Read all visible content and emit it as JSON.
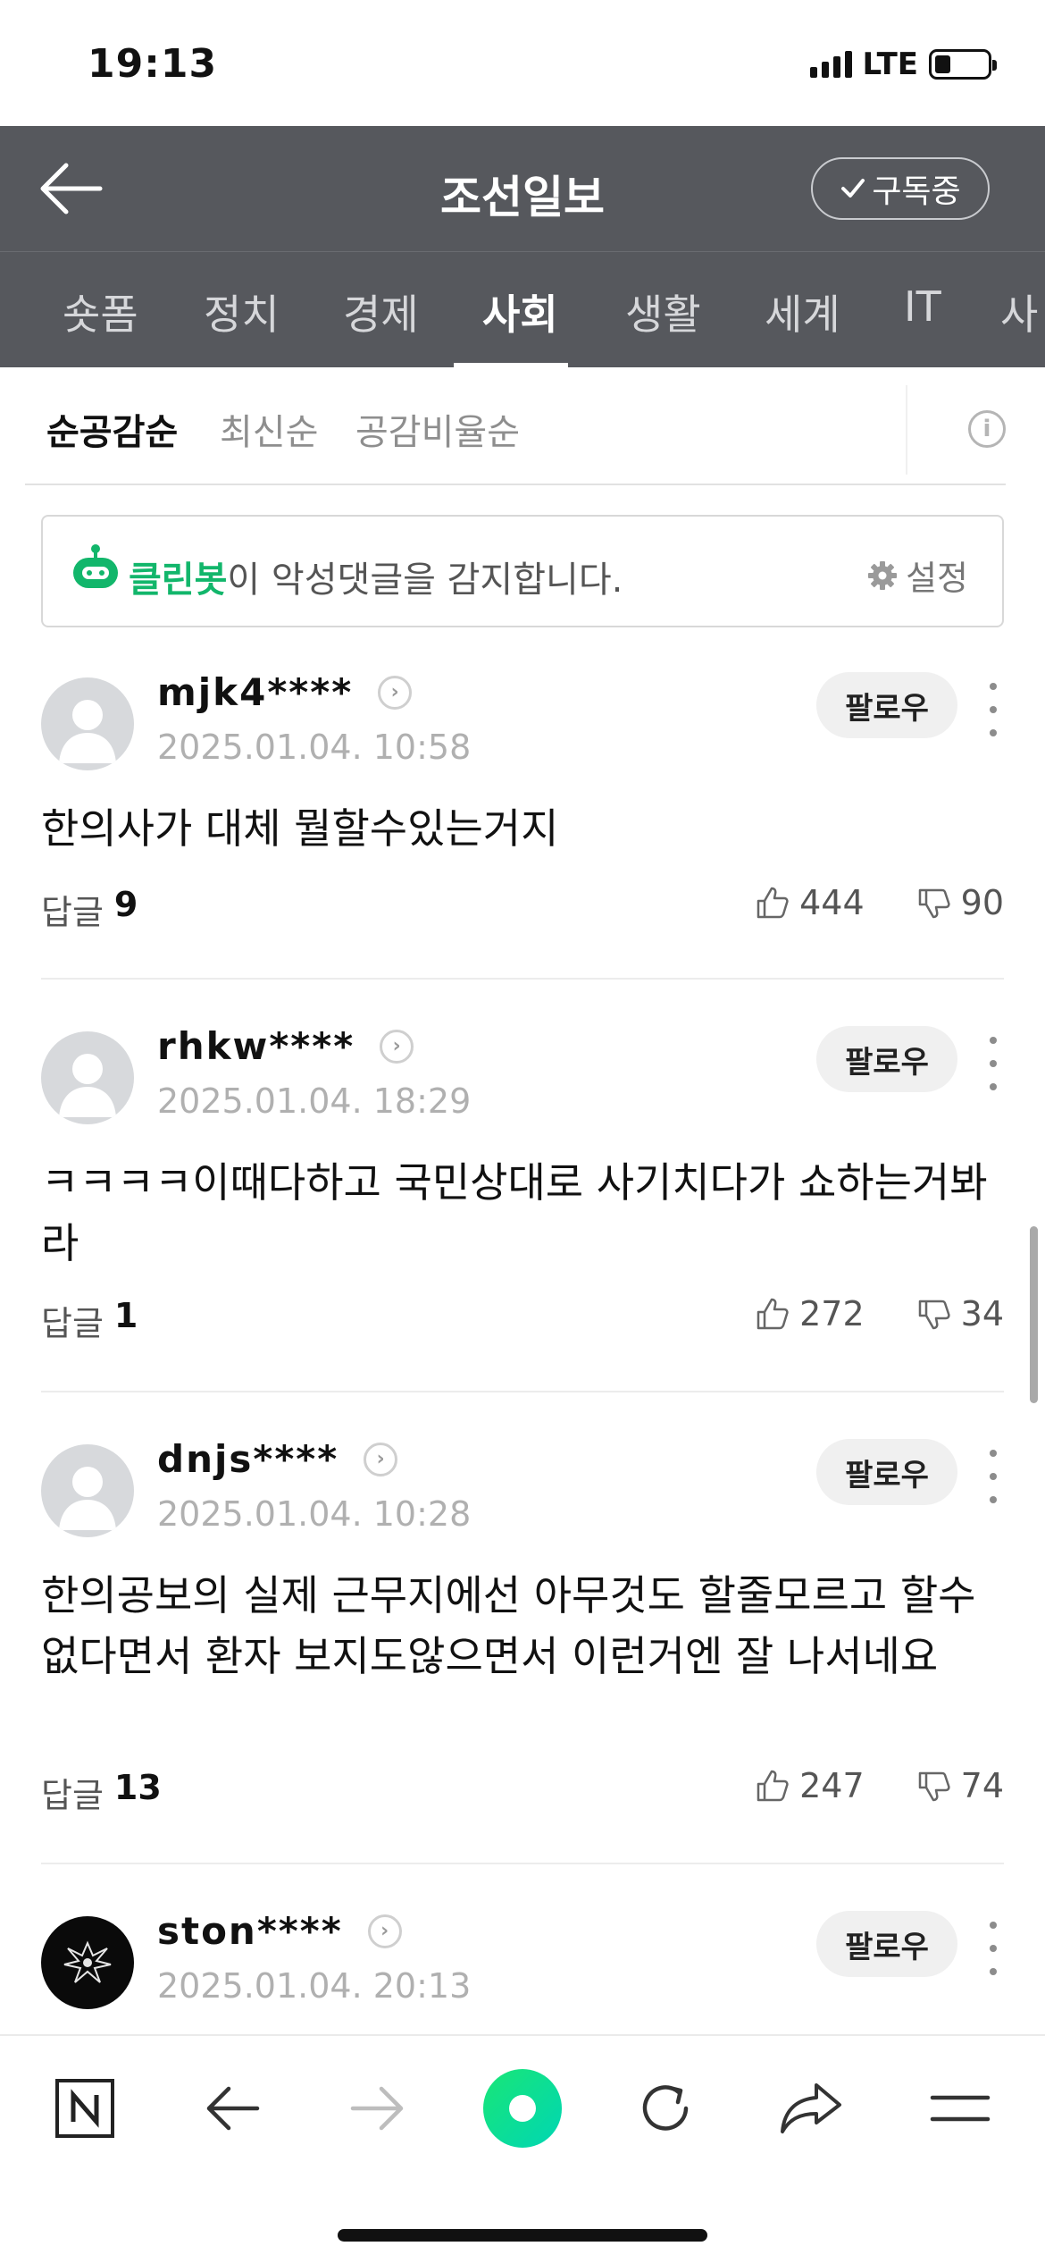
{
  "status_bar": {
    "time": "19:13",
    "network": "LTE",
    "battery_level": 0.3
  },
  "header": {
    "title": "조선일보",
    "subscribe_label": "구독중",
    "background": "#56585d"
  },
  "categories": [
    {
      "label": "숏폼",
      "active": false
    },
    {
      "label": "정치",
      "active": false
    },
    {
      "label": "경제",
      "active": false
    },
    {
      "label": "사회",
      "active": true
    },
    {
      "label": "생활",
      "active": false
    },
    {
      "label": "세계",
      "active": false
    },
    {
      "label": "IT",
      "active": false
    },
    {
      "label": "사",
      "active": false
    }
  ],
  "sort": {
    "options": [
      {
        "label": "순공감순",
        "active": true
      },
      {
        "label": "최신순",
        "active": false
      },
      {
        "label": "공감비율순",
        "active": false
      }
    ],
    "info_icon": "i"
  },
  "cleanbot": {
    "brand": "클린봇",
    "message": "이 악성댓글을 감지합니다.",
    "settings_label": "설정",
    "brand_color": "#12b66b"
  },
  "comments": [
    {
      "username": "mjk4****",
      "date": "2025.01.04. 10:58",
      "text": "한의사가 대체 뭘할수있는거지",
      "reply_label": "답글",
      "reply_count": "9",
      "likes": "444",
      "dislikes": "90",
      "follow_label": "팔로우"
    },
    {
      "username": "rhkw****",
      "date": "2025.01.04. 18:29",
      "text": "ㅋㅋㅋㅋ이때다하고 국민상대로 사기치다가 쇼하는거봐라",
      "reply_label": "답글",
      "reply_count": "1",
      "likes": "272",
      "dislikes": "34",
      "follow_label": "팔로우"
    },
    {
      "username": "dnjs****",
      "date": "2025.01.04. 10:28",
      "text": "한의공보의 실제 근무지에선 아무것도 할줄모르고 할수없다면서 환자 보지도않으면서 이런거엔 잘 나서네요",
      "reply_label": "답글",
      "reply_count": "13",
      "likes": "247",
      "dislikes": "74",
      "follow_label": "팔로우"
    },
    {
      "username": "ston****",
      "date": "2025.01.04. 20:13",
      "follow_label": "팔로우"
    }
  ],
  "toolbar": {
    "items": [
      "naver-home-icon",
      "back-arrow-icon",
      "forward-arrow-icon",
      "green-dot-icon",
      "refresh-icon",
      "share-icon",
      "menu-icon"
    ],
    "accent": "#03e08a"
  }
}
